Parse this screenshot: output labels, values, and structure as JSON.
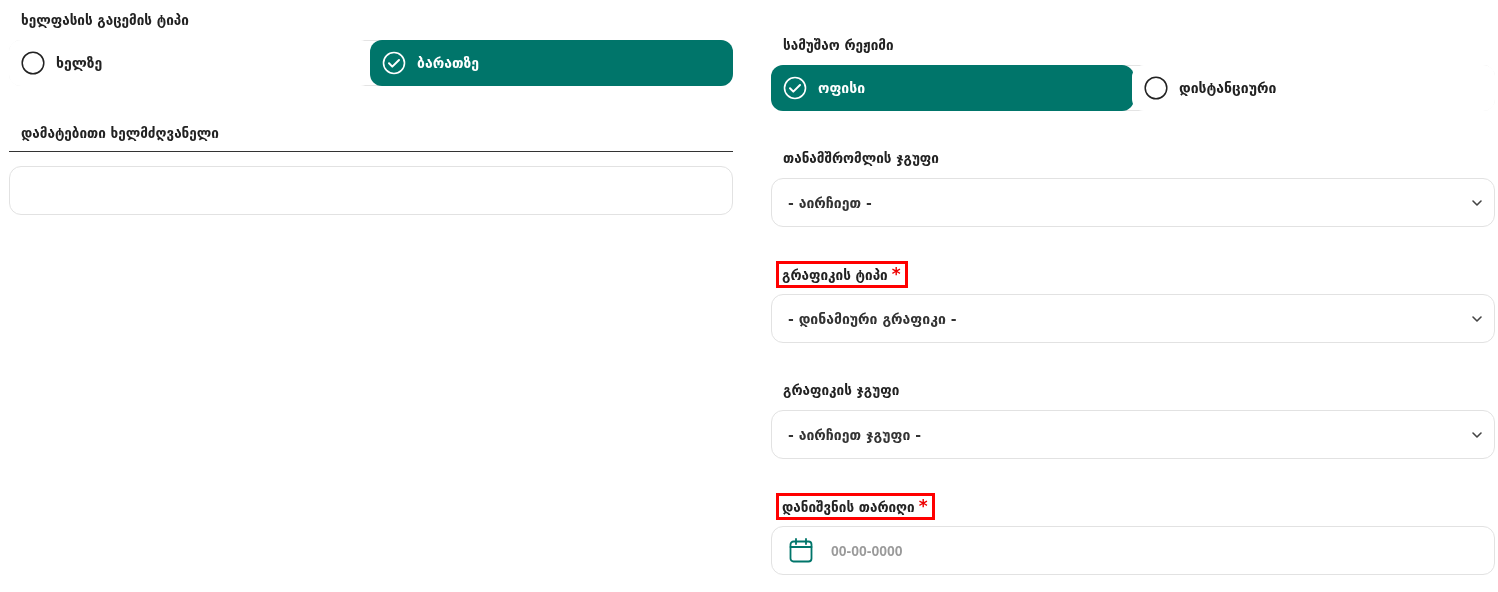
{
  "columns": [
    {
      "fields": [
        {
          "kind": "radio",
          "label": "ხელფასის გაცემის ტიპი",
          "highlighted": false,
          "options": [
            {
              "label": "ხელზე",
              "selected": false
            },
            {
              "label": "ბარათზე",
              "selected": true
            }
          ]
        },
        {
          "kind": "text",
          "label": "დამატებითი ხელმძღვანელი",
          "highlighted": false
        }
      ]
    },
    {
      "fields": [
        {
          "kind": "radio",
          "label": "სამუშაო რეჟიმი",
          "highlighted": false,
          "options": [
            {
              "label": "ოფისი",
              "selected": true
            },
            {
              "label": "დისტანციური",
              "selected": false
            }
          ]
        },
        {
          "kind": "select",
          "label": "თანამშრომლის ჯგუფი",
          "highlighted": false,
          "value": "- აირჩიეთ -"
        },
        {
          "kind": "select",
          "label": "გრაფიკის ტიპი",
          "highlighted": true,
          "required_mark": "*",
          "value": "- დინამიური გრაფიკი -"
        },
        {
          "kind": "select",
          "label": "გრაფიკის ჯგუფი",
          "highlighted": false,
          "value": "- აირჩიეთ ჯგუფი -"
        },
        {
          "kind": "date",
          "label": "დანიშვნის თარიღი",
          "highlighted": true,
          "required_mark": "*",
          "placeholder": "00-00-0000"
        }
      ]
    }
  ]
}
